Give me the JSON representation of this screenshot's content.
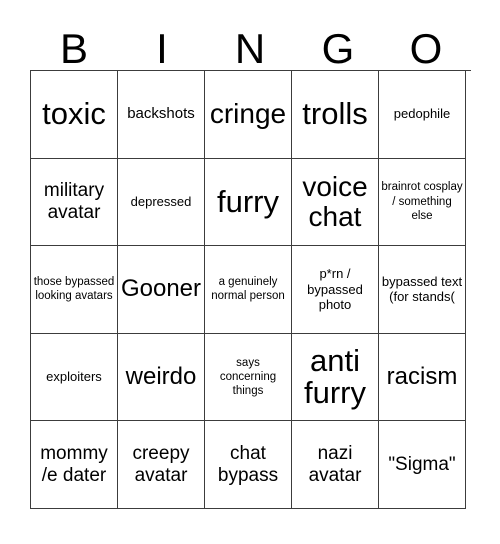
{
  "card": {
    "header_letters": [
      "B",
      "I",
      "N",
      "G",
      "O"
    ],
    "grid": [
      [
        {
          "text": "toxic",
          "size": "fs-xxl"
        },
        {
          "text": "backshots",
          "size": "fs-s"
        },
        {
          "text": "cringe",
          "size": "fs-xl"
        },
        {
          "text": "trolls",
          "size": "fs-xxl"
        },
        {
          "text": "pedophile",
          "size": "fs-xs"
        }
      ],
      [
        {
          "text": "military avatar",
          "size": "fs-m"
        },
        {
          "text": "depressed",
          "size": "fs-xs"
        },
        {
          "text": "furry",
          "size": "fs-xxl"
        },
        {
          "text": "voice chat",
          "size": "fs-xl"
        },
        {
          "text": "brainrot cosplay / something else",
          "size": "fs-xxs"
        }
      ],
      [
        {
          "text": "those bypassed looking avatars",
          "size": "fs-xxs"
        },
        {
          "text": "Gooner",
          "size": "fs-l"
        },
        {
          "text": "a genuinely normal person",
          "size": "fs-xxs"
        },
        {
          "text": "p*rn / bypassed photo",
          "size": "fs-xs"
        },
        {
          "text": "bypassed text (for stands(",
          "size": "fs-xs"
        }
      ],
      [
        {
          "text": "exploiters",
          "size": "fs-xs"
        },
        {
          "text": "weirdo",
          "size": "fs-l"
        },
        {
          "text": "says concerning things",
          "size": "fs-xxs"
        },
        {
          "text": "anti furry",
          "size": "fs-xxl"
        },
        {
          "text": "racism",
          "size": "fs-l"
        }
      ],
      [
        {
          "text": "mommy /e dater",
          "size": "fs-m"
        },
        {
          "text": "creepy avatar",
          "size": "fs-m"
        },
        {
          "text": "chat bypass",
          "size": "fs-m"
        },
        {
          "text": "nazi avatar",
          "size": "fs-m"
        },
        {
          "text": "\"Sigma\"",
          "size": "fs-m"
        }
      ]
    ]
  },
  "colors": {
    "background": "#ffffff",
    "text": "#000000",
    "border": "#3c3c3c"
  }
}
